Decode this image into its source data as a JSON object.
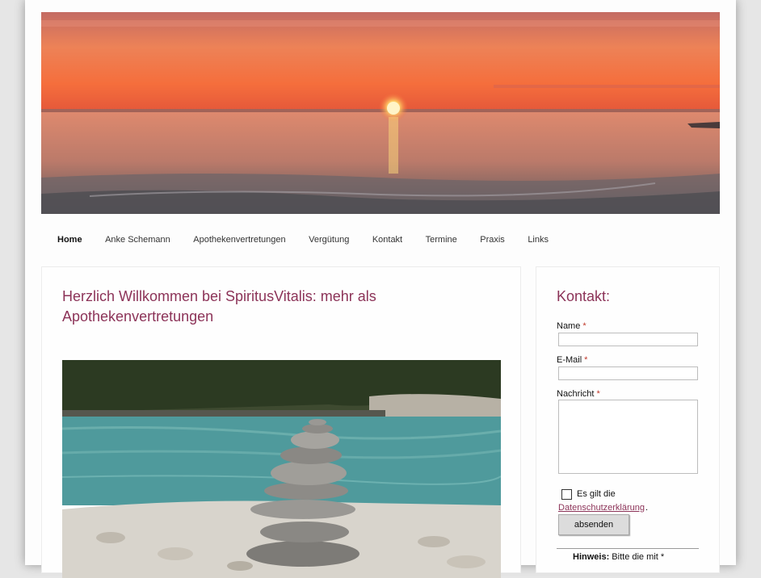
{
  "nav": {
    "items": [
      {
        "label": "Home",
        "active": true
      },
      {
        "label": "Anke Schemann",
        "active": false
      },
      {
        "label": "Apothekenvertretungen",
        "active": false
      },
      {
        "label": "Vergütung",
        "active": false
      },
      {
        "label": "Kontakt",
        "active": false
      },
      {
        "label": "Termine",
        "active": false
      },
      {
        "label": "Praxis",
        "active": false
      },
      {
        "label": "Links",
        "active": false
      }
    ]
  },
  "main": {
    "title": "Herzlich Willkommen bei SpiritusVitalis: mehr als Apothekenvertretungen"
  },
  "contact": {
    "title": "Kontakt:",
    "name_label": "Name",
    "email_label": "E-Mail",
    "message_label": "Nachricht",
    "required_mark": "*",
    "name_value": "",
    "email_value": "",
    "message_value": "",
    "privacy_text": "Es gilt die",
    "privacy_link": "Datenschutzerklärung",
    "privacy_end": ".",
    "submit_label": "absenden",
    "hint_bold": "Hinweis:",
    "hint_text": "Bitte die mit *"
  },
  "colors": {
    "accent": "#8c3358",
    "background": "#e6e6e6",
    "page": "#fdfdfd"
  }
}
